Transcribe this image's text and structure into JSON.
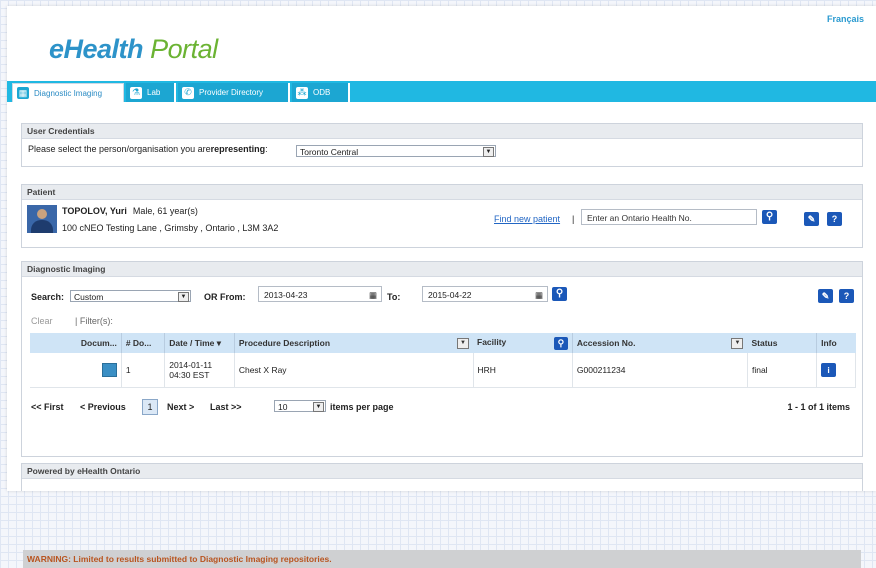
{
  "language_link": "Français",
  "logo": {
    "part1": "eHealth",
    "part2": "Portal"
  },
  "tabs": [
    {
      "label": "Diagnostic Imaging",
      "icon": "imaging-icon"
    },
    {
      "label": "Lab",
      "icon": "lab-flask-icon"
    },
    {
      "label": "Provider Directory",
      "icon": "phone-icon"
    },
    {
      "label": "ODB",
      "icon": "pills-icon"
    }
  ],
  "credentials": {
    "title": "User Credentials",
    "prompt_prefix": "Please select the person/organisation you are ",
    "prompt_bold": "representing",
    "prompt_suffix": ":",
    "selected": "Toronto Central"
  },
  "patient": {
    "title": "Patient",
    "name": "TOPOLOV, Yuri",
    "details": "Male, 61 year(s)",
    "address": "100 cNEO Testing Lane , Grimsby , Ontario , L3M 3A2",
    "find_new": "Find new patient",
    "separator": "|",
    "health_no_placeholder": "Enter an Ontario Health No."
  },
  "imaging": {
    "title": "Diagnostic Imaging",
    "search_label": "Search:",
    "search_value": "Custom",
    "or_from_label": "OR From:",
    "from_date": "2013-04-23",
    "to_label": "To:",
    "to_date": "2015-04-22",
    "clear": "Clear",
    "filters": "| Filter(s):",
    "columns": [
      "Docum...",
      "# Do...",
      "Date / Time ▾",
      "Procedure Description",
      "Facility",
      "Accession No.",
      "Status",
      "Info"
    ],
    "rows": [
      {
        "num": "1",
        "date": "2014-01-11",
        "time": "04:30 EST",
        "procedure": "Chest X Ray",
        "facility": "HRH",
        "accession": "G000211234",
        "status": "final"
      }
    ],
    "pager": {
      "first": "<< First",
      "prev": "< Previous",
      "page": "1",
      "next": "Next >",
      "last": "Last >>",
      "per_page": "10",
      "per_page_label": "items per page",
      "summary": "1 - 1 of 1 items"
    },
    "warning": "WARNING: Limited to results submitted to Diagnostic Imaging repositories."
  },
  "footer": {
    "title": "Powered by eHealth Ontario"
  },
  "colors": {
    "tabbar": "#20b8e2",
    "brand_blue": "#2d93c9",
    "brand_green": "#6bb333",
    "warning": "#b8541f"
  }
}
